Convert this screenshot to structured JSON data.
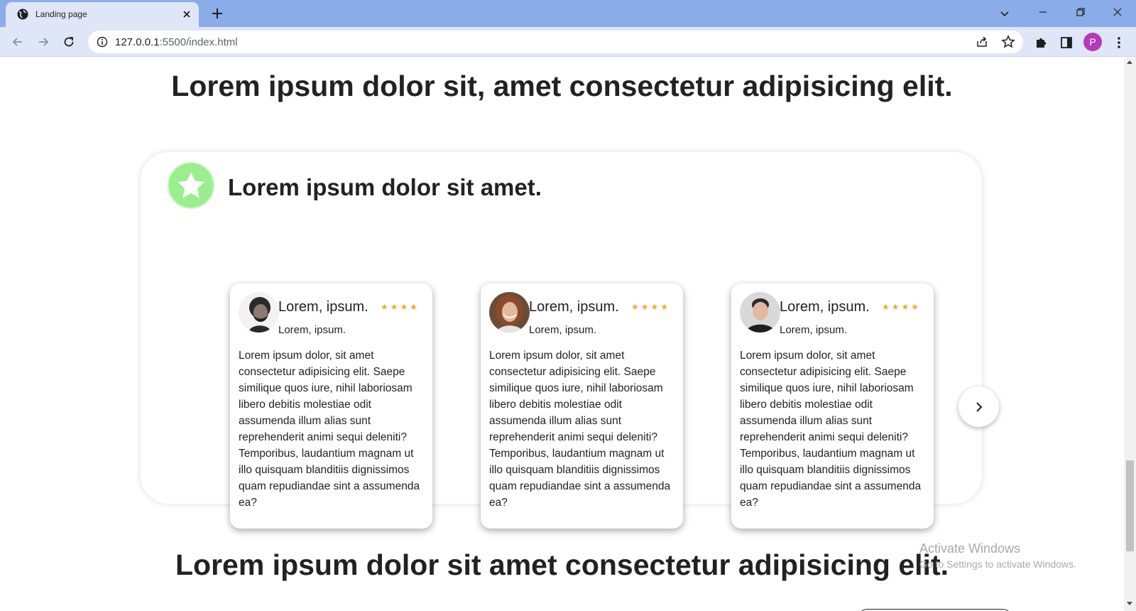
{
  "browser": {
    "tab_title": "Landing page",
    "url_host": "127.0.0.1",
    "url_rest": ":5500/index.html",
    "profile_initial": "P",
    "accent": "#8aace8"
  },
  "page": {
    "heading_top": "Lorem ipsum dolor sit, amet consectetur adipisicing elit.",
    "heading_bottom": "Lorem ipsum dolor sit amet consectetur adipisicing elit.",
    "panel_title": "Lorem ipsum dolor sit amet.",
    "badge_color": "#9aee8e",
    "star_color": "#f0a92b",
    "testimonials": [
      {
        "name": "Lorem, ipsum.",
        "subtitle": "Lorem, ipsum.",
        "rating": 4,
        "text": "Lorem ipsum dolor, sit amet consectetur adipisicing elit. Saepe similique quos iure, nihil laboriosam libero debitis molestiae odit assumenda illum alias sunt reprehenderit animi sequi deleniti? Temporibus, laudantium magnam ut illo quisquam blanditiis dignissimos quam repudiandae sint a assumenda ea?"
      },
      {
        "name": "Lorem, ipsum.",
        "subtitle": "Lorem, ipsum.",
        "rating": 4,
        "text": "Lorem ipsum dolor, sit amet consectetur adipisicing elit. Saepe similique quos iure, nihil laboriosam libero debitis molestiae odit assumenda illum alias sunt reprehenderit animi sequi deleniti? Temporibus, laudantium magnam ut illo quisquam blanditiis dignissimos quam repudiandae sint a assumenda ea?"
      },
      {
        "name": "Lorem, ipsum.",
        "subtitle": "Lorem, ipsum.",
        "rating": 4,
        "text": "Lorem ipsum dolor, sit amet consectetur adipisicing elit. Saepe similique quos iure, nihil laboriosam libero debitis molestiae odit assumenda illum alias sunt reprehenderit animi sequi deleniti? Temporibus, laudantium magnam ut illo quisquam blanditiis dignissimos quam repudiandae sint a assumenda ea?"
      }
    ]
  },
  "watermark": {
    "title": "Activate Windows",
    "subtitle": "Go to Settings to activate Windows."
  }
}
